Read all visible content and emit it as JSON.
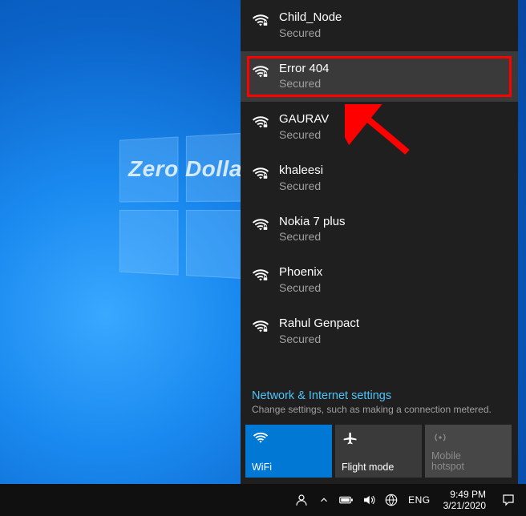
{
  "watermark": "Zero Dollar Tips",
  "networks": [
    {
      "name": "Child_Node",
      "status": "Secured",
      "selected": false
    },
    {
      "name": "Error 404",
      "status": "Secured",
      "selected": true
    },
    {
      "name": "GAURAV",
      "status": "Secured",
      "selected": false
    },
    {
      "name": "khaleesi",
      "status": "Secured",
      "selected": false
    },
    {
      "name": "Nokia 7 plus",
      "status": "Secured",
      "selected": false
    },
    {
      "name": "Phoenix",
      "status": "Secured",
      "selected": false
    },
    {
      "name": "Rahul Genpact",
      "status": "Secured",
      "selected": false
    }
  ],
  "settings": {
    "title": "Network & Internet settings",
    "subtitle": "Change settings, such as making a connection metered."
  },
  "tiles": {
    "wifi": "WiFi",
    "flight": "Flight mode",
    "hotspot_line1": "Mobile",
    "hotspot_line2": "hotspot"
  },
  "taskbar": {
    "language": "ENG",
    "time": "9:49 PM",
    "date": "3/21/2020"
  }
}
